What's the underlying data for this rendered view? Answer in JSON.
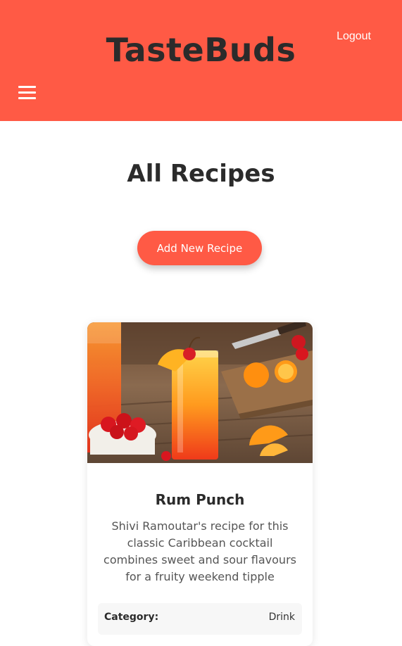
{
  "header": {
    "brand": "TasteBuds",
    "logout_label": "Logout",
    "menu_icon": "hamburger-menu-icon",
    "background_color": "#ff5a45"
  },
  "main": {
    "title": "All Recipes",
    "add_button_label": "Add New Recipe"
  },
  "recipes": [
    {
      "image": "rum-punch-photo",
      "title": "Rum Punch",
      "description": "Shivi Ramoutar's recipe for this classic Caribbean cocktail combines sweet and sour flavours for a fruity weekend tipple",
      "category_label": "Category:",
      "category": "Drink"
    }
  ],
  "colors": {
    "accent": "#ff5a45",
    "text": "#2b2b2b",
    "muted_text": "#555555"
  }
}
